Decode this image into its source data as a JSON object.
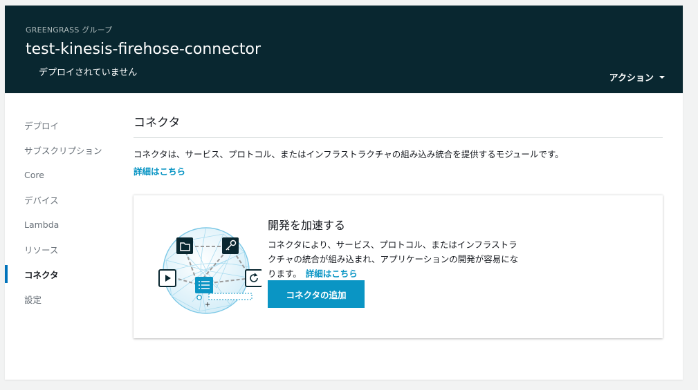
{
  "header": {
    "eyebrow": "GREENGRASS グループ",
    "title": "test-kinesis-firehose-connector",
    "status": "デプロイされていません",
    "actions_label": "アクション",
    "background": "#092730"
  },
  "sidenav": {
    "items": [
      {
        "label": "デプロイ",
        "active": false
      },
      {
        "label": "サブスクリプション",
        "active": false
      },
      {
        "label": "Core",
        "active": false
      },
      {
        "label": "デバイス",
        "active": false
      },
      {
        "label": "Lambda",
        "active": false
      },
      {
        "label": "リソース",
        "active": false
      },
      {
        "label": "コネクタ",
        "active": true
      },
      {
        "label": "設定",
        "active": false
      }
    ]
  },
  "section": {
    "title": "コネクタ",
    "description": "コネクタは、サービス、プロトコル、またはインフラストラクチャの組み込み統合を提供するモジュールです。",
    "learn_more": "詳細はこちら"
  },
  "card": {
    "title": "開発を加速する",
    "description": "コネクタにより、サービス、プロトコル、またはインフラストラクチャの統合が組み込まれ、アプリケーションの開発が容易になります。",
    "learn_more": "詳細はこちら",
    "add_button": "コネクタの追加",
    "accent": "#0a95c4"
  }
}
